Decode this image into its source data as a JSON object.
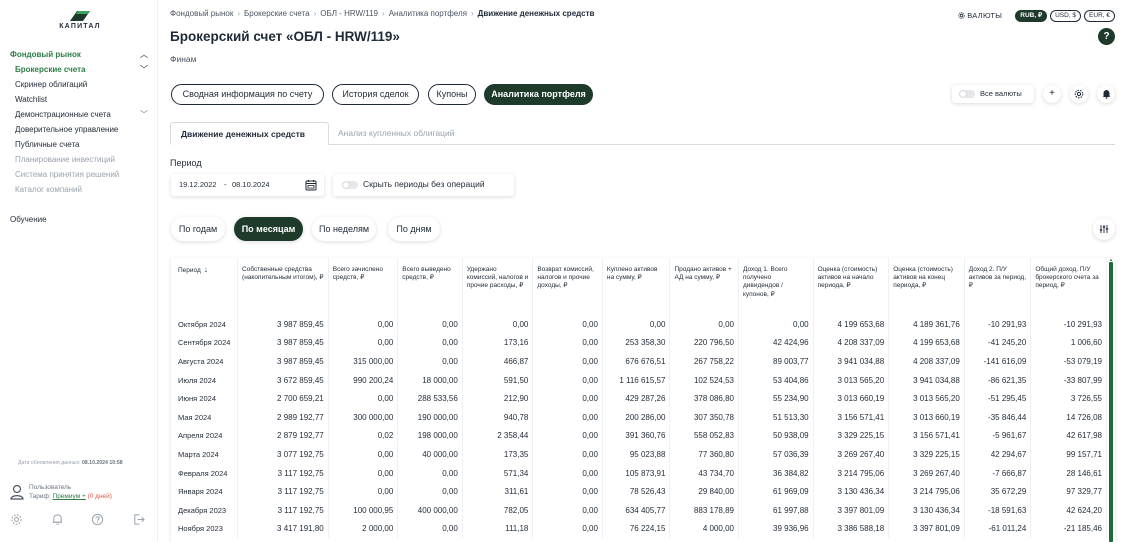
{
  "sidebar": {
    "logo_text": "КАПИТАЛ",
    "items": [
      {
        "label": "Фондовый рынок",
        "kind": "top",
        "chevron": "up"
      },
      {
        "label": "Брокерские счета",
        "kind": "active",
        "chevron": "down"
      },
      {
        "label": "Скринер облигаций",
        "kind": "normal"
      },
      {
        "label": "Watchlist",
        "kind": "normal"
      },
      {
        "label": "Демонстрационные счета",
        "kind": "normal",
        "chevron": "down"
      },
      {
        "label": "Доверительное управление",
        "kind": "normal"
      },
      {
        "label": "Публичные счета",
        "kind": "normal"
      },
      {
        "label": "Планирование инвестиций",
        "kind": "muted"
      },
      {
        "label": "Система принятия решений",
        "kind": "muted"
      },
      {
        "label": "Каталог компаний",
        "kind": "muted"
      }
    ],
    "learning": "Обучение",
    "update_label": "Дата обновления данных:",
    "update_value": "08.10.2024 10:58",
    "user_name": "Пользователь",
    "tariff_label": "Тариф:",
    "tariff_plan": "Премиум +",
    "tariff_days": "(0 дней)",
    "bottom_icons": [
      "gear-icon",
      "bell-icon",
      "help-icon",
      "logout-icon"
    ]
  },
  "breadcrumb": [
    "Фондовый рынок",
    "Брокерские счета",
    "ОБЛ - HRW/119",
    "Аналитика портфеля",
    "Движение денежных средств"
  ],
  "currencies": {
    "label": "ВАЛЮТЫ",
    "options": [
      {
        "label": "RUB, ₽",
        "active": true
      },
      {
        "label": "USD, $",
        "active": false
      },
      {
        "label": "EUR, €",
        "active": false
      }
    ]
  },
  "page": {
    "title": "Брокерский счет «ОБЛ - HRW/119»",
    "subtitle": "Финам",
    "help": "?"
  },
  "tabs": [
    {
      "label": "Сводная информация по счету",
      "active": false
    },
    {
      "label": "История сделок",
      "active": false
    },
    {
      "label": "Купоны",
      "active": false
    },
    {
      "label": "Аналитика портфеля",
      "active": true
    }
  ],
  "toolbar": {
    "all_currencies": "Все валюты",
    "all_currencies_on": false
  },
  "subtabs": [
    {
      "label": "Движение денежных средств",
      "active": true
    },
    {
      "label": "Анализ купленных облигаций",
      "active": false
    }
  ],
  "period": {
    "label": "Период",
    "from": "19.12.2022",
    "dash": "-",
    "to": "08.10.2024",
    "hide_empty_label": "Скрыть периоды без операций",
    "hide_empty_on": false
  },
  "granularity": [
    {
      "label": "По годам",
      "active": false
    },
    {
      "label": "По месяцам",
      "active": true
    },
    {
      "label": "По неделям",
      "active": false
    },
    {
      "label": "По дням",
      "active": false
    }
  ],
  "table": {
    "columns": [
      "Период",
      "Собственные средства (накопительным итогом), ₽",
      "Всего зачислено средств, ₽",
      "Всего выведено средств, ₽",
      "Удержано комиссий, налогов и прочие расходы, ₽",
      "Возврат комиссий, налогов и прочие доходы, ₽",
      "Куплено активов на сумму, ₽",
      "Продано активов + АД на сумму, ₽",
      "Доход 1. Всего получено дивидендов / купонов, ₽",
      "Оценка (стоимость) активов на начало периода, ₽",
      "Оценка (стоимость) активов на конец периода, ₽",
      "Доход 2. П/У активов за период, ₽",
      "Общий доход. П/У брокерского счета за период, ₽"
    ],
    "rows": [
      [
        "Октября 2024",
        "3 987 859,45",
        "0,00",
        "0,00",
        "0,00",
        "0,00",
        "0,00",
        "0,00",
        "0,00",
        "4 199 653,68",
        "4 189 361,76",
        "-10 291,93",
        "-10 291,93"
      ],
      [
        "Сентября 2024",
        "3 987 859,45",
        "0,00",
        "0,00",
        "173,16",
        "0,00",
        "253 358,30",
        "220 796,50",
        "42 424,96",
        "4 208 337,09",
        "4 199 653,68",
        "-41 245,20",
        "1 006,60"
      ],
      [
        "Августа 2024",
        "3 987 859,45",
        "315 000,00",
        "0,00",
        "466,87",
        "0,00",
        "676 676,51",
        "267 758,22",
        "89 003,77",
        "3 941 034,88",
        "4 208 337,09",
        "-141 616,09",
        "-53 079,19"
      ],
      [
        "Июля 2024",
        "3 672 859,45",
        "990 200,24",
        "18 000,00",
        "591,50",
        "0,00",
        "1 116 615,57",
        "102 524,53",
        "53 404,86",
        "3 013 565,20",
        "3 941 034,88",
        "-86 621,35",
        "-33 807,99"
      ],
      [
        "Июня 2024",
        "2 700 659,21",
        "0,00",
        "288 533,56",
        "212,90",
        "0,00",
        "429 287,26",
        "378 086,80",
        "55 234,90",
        "3 013 660,19",
        "3 013 565,20",
        "-51 295,45",
        "3 726,55"
      ],
      [
        "Мая 2024",
        "2 989 192,77",
        "300 000,00",
        "190 000,00",
        "940,78",
        "0,00",
        "200 286,00",
        "307 350,78",
        "51 513,30",
        "3 156 571,41",
        "3 013 660,19",
        "-35 846,44",
        "14 726,08"
      ],
      [
        "Апреля 2024",
        "2 879 192,77",
        "0,02",
        "198 000,00",
        "2 358,44",
        "0,00",
        "391 360,76",
        "558 052,83",
        "50 938,09",
        "3 329 225,15",
        "3 156 571,41",
        "-5 961,67",
        "42 617,98"
      ],
      [
        "Марта 2024",
        "3 077 192,75",
        "0,00",
        "40 000,00",
        "173,35",
        "0,00",
        "95 023,88",
        "77 360,80",
        "57 036,39",
        "3 269 267,40",
        "3 329 225,15",
        "42 294,67",
        "99 157,71"
      ],
      [
        "Февраля 2024",
        "3 117 192,75",
        "0,00",
        "0,00",
        "571,34",
        "0,00",
        "105 873,91",
        "43 734,70",
        "36 384,82",
        "3 214 795,06",
        "3 269 267,40",
        "-7 666,87",
        "28 146,61"
      ],
      [
        "Января 2024",
        "3 117 192,75",
        "0,00",
        "0,00",
        "311,61",
        "0,00",
        "78 526,43",
        "29 840,00",
        "61 969,09",
        "3 130 436,34",
        "3 214 795,06",
        "35 672,29",
        "97 329,77"
      ],
      [
        "Декабря 2023",
        "3 117 192,75",
        "100 000,95",
        "400 000,00",
        "782,05",
        "0,00",
        "634 405,77",
        "883 178,89",
        "61 997,88",
        "3 397 801,09",
        "3 130 436,34",
        "-18 591,63",
        "42 624,20"
      ],
      [
        "Ноября 2023",
        "3 417 191,80",
        "2 000,00",
        "0,00",
        "111,18",
        "0,00",
        "76 224,15",
        "4 000,00",
        "39 936,96",
        "3 386 588,18",
        "3 397 801,09",
        "-61 011,24",
        "-21 185,46"
      ]
    ]
  }
}
